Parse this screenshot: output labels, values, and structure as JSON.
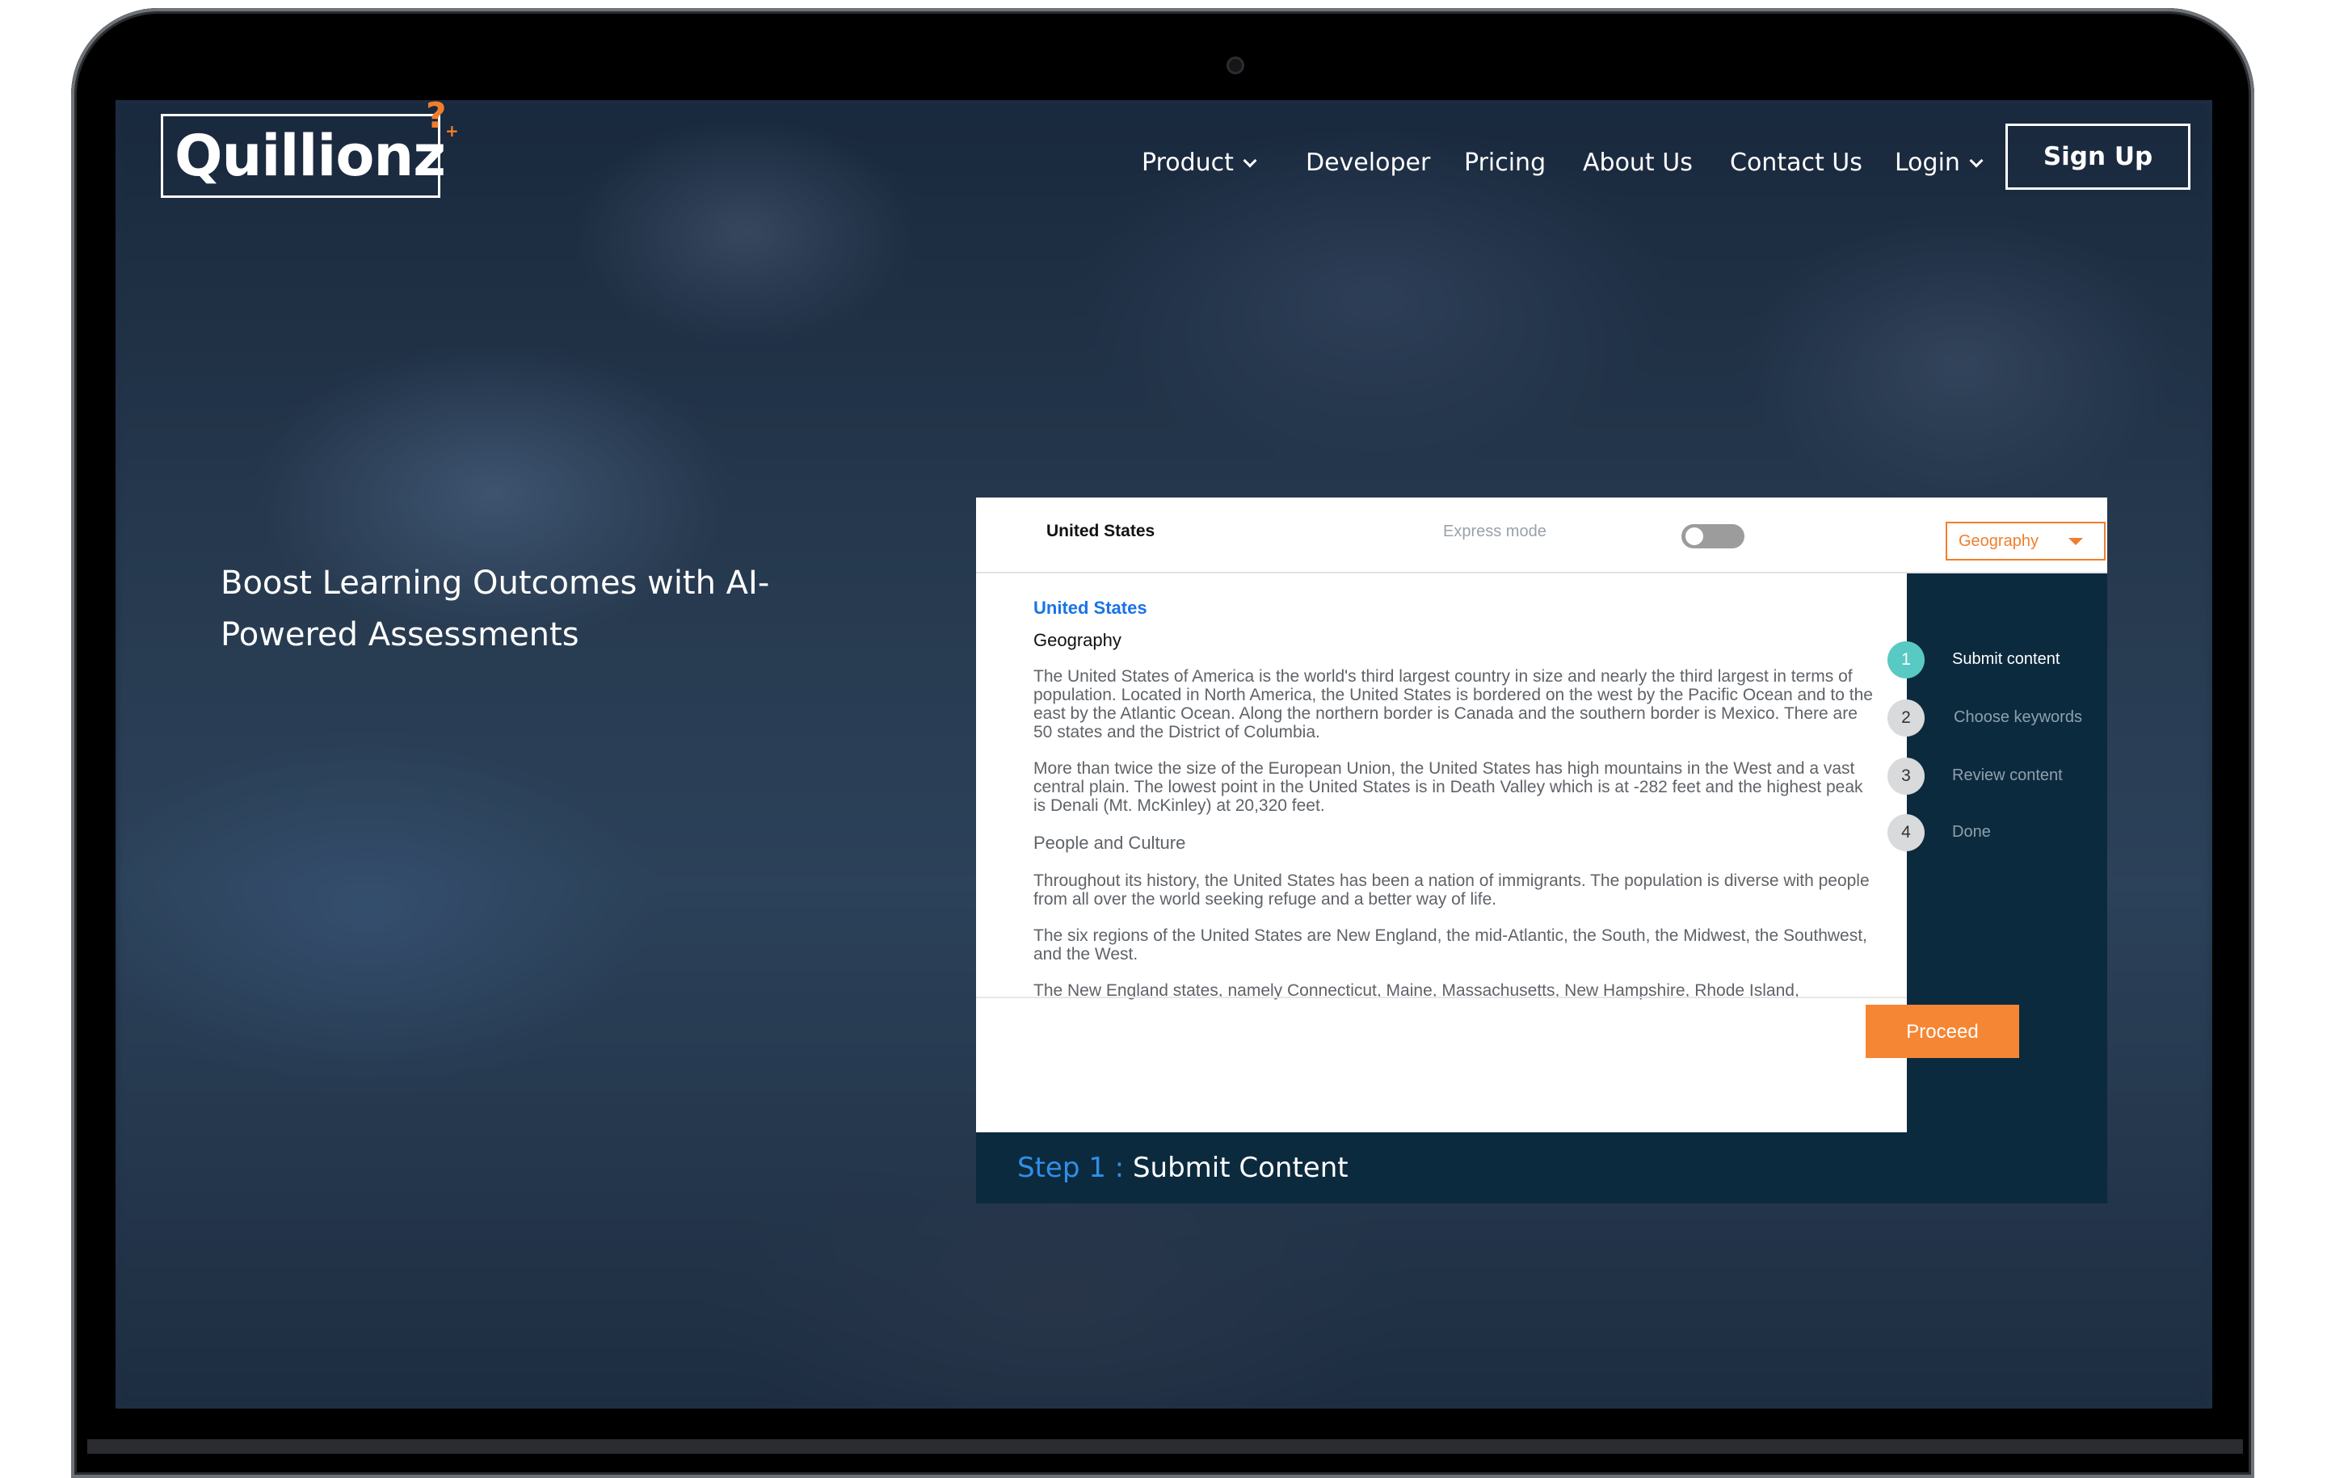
{
  "brand": {
    "logo_text": "Quillionz",
    "logo_mark": "?",
    "logo_plus": "+",
    "accent_color": "#f07e2c"
  },
  "nav": {
    "items": [
      {
        "label": "Product",
        "has_dropdown": true
      },
      {
        "label": "Developer",
        "has_dropdown": false
      },
      {
        "label": "Pricing",
        "has_dropdown": false
      },
      {
        "label": "About Us",
        "has_dropdown": false
      },
      {
        "label": "Contact Us",
        "has_dropdown": false
      },
      {
        "label": "Login",
        "has_dropdown": true
      }
    ],
    "signup_label": "Sign Up"
  },
  "hero": {
    "title": "Boost Learning Outcomes with AI-Powered Assessments"
  },
  "app": {
    "doc_name": "United States",
    "express_mode_label": "Express mode",
    "express_mode_on": false,
    "subject_selected": "Geography",
    "content": {
      "heading": "United States",
      "subheading": "Geography",
      "paragraphs": [
        "The United States of America is the world's third largest country in  size and nearly the third largest in terms of population. Located in North America, the United States is bordered on the west by the Pacific Ocean and to the east by the Atlantic Ocean. Along the northern border is Canada and the southern border is Mexico. There are 50 states and the District of Columbia.",
        "More than twice the size of the European Union, the United States has high mountains in the West and a vast central plain. The lowest point in the United States is in Death Valley which is at -282 feet and the highest peak is Denali (Mt. McKinley) at 20,320 feet."
      ],
      "section_title": "People and Culture",
      "paragraphs_2": [
        "Throughout its history, the United States has been a nation of immigrants. The population is diverse with people from all over the world seeking refuge and a better way of life.",
        "The six regions of the United States are New England, the mid-Atlantic, the South, the Midwest, the Southwest, and the West.",
        "The New England states, namely Connecticut, Maine, Massachusetts, New Hampshire, Rhode Island,"
      ]
    },
    "proceed_label": "Proceed",
    "steps": [
      {
        "num": "1",
        "label": "Submit content",
        "active": true
      },
      {
        "num": "2",
        "label": "Choose keywords",
        "active": false
      },
      {
        "num": "3",
        "label": "Review content",
        "active": false
      },
      {
        "num": "4",
        "label": "Done",
        "active": false
      }
    ],
    "banner": {
      "prefix": "Step 1 :",
      "title": "Submit Content"
    }
  }
}
